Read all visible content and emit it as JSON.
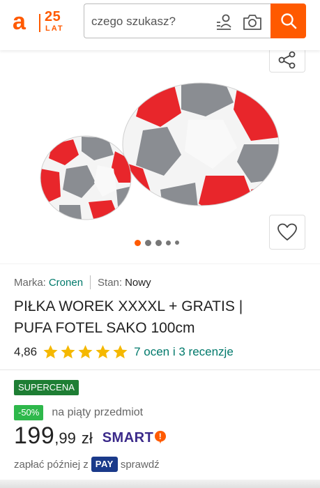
{
  "header": {
    "logo_letter": "a",
    "logo_number": "25",
    "logo_suffix": "LAT",
    "search_placeholder": "czego szukasz?",
    "accent_color": "#ff5a00"
  },
  "gallery": {
    "dots_count": 5,
    "active_dot": 0
  },
  "product": {
    "brand_label": "Marka:",
    "brand_value": "Cronen",
    "condition_label": "Stan:",
    "condition_value": "Nowy",
    "title_line1": "PIŁKA WOREK XXXXL + GRATIS |",
    "title_line2": "PUFA FOTEL SAKO 100cm",
    "rating_value": "4,86",
    "stars_filled": 5,
    "reviews_link": "7 ocen i 3 recenzje"
  },
  "pricing": {
    "badge": "SUPERCENA",
    "discount_badge": "-50%",
    "discount_text": "na piąty przedmiot",
    "price_integer": "199",
    "price_decimal": ",99",
    "currency": "zł",
    "smart_label": "SMART",
    "smart_mark": "!",
    "pay_prefix": "zapłać później z",
    "pay_badge": "PAY",
    "pay_suffix": "sprawdź"
  },
  "colors": {
    "link": "#00796b",
    "star": "#f5b800",
    "supercena_bg": "#1e7e34",
    "discount_bg": "#2eb84b",
    "smart": "#3b2a8a",
    "pay_bg": "#1a3a8a"
  }
}
